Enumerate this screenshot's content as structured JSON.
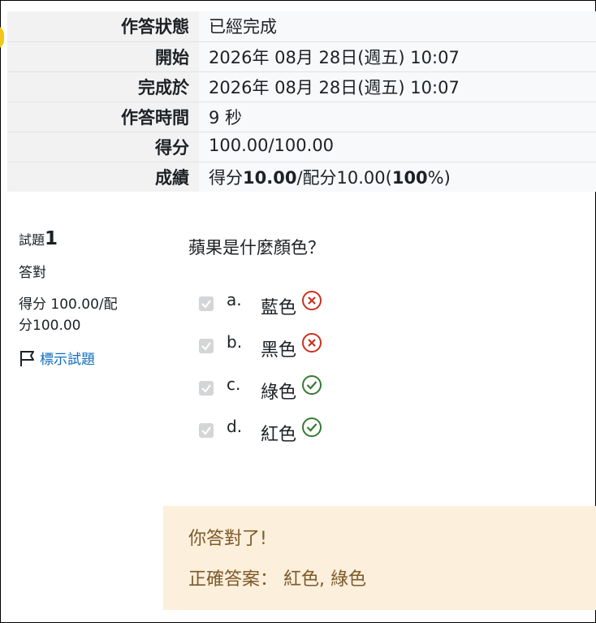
{
  "summary": {
    "rows": [
      {
        "label": "作答狀態",
        "value": "已經完成"
      },
      {
        "label": "開始",
        "value": "2026年 08月 28日(週五) 10:07"
      },
      {
        "label": "完成於",
        "value": "2026年 08月 28日(週五) 10:07"
      },
      {
        "label": "作答時間",
        "value": "9 秒"
      },
      {
        "label": "得分",
        "value": "100.00/100.00"
      }
    ],
    "grade": {
      "label": "成績",
      "prefix": "得分",
      "score": "10.00",
      "mid": "/配分10.00(",
      "percent": "100",
      "suffix": "%)"
    }
  },
  "question": {
    "number_prefix": "試題",
    "number": "1",
    "state": "答對",
    "grade_line1": "得分 100.00/配",
    "grade_line2": "分100.00",
    "flag_label": "標示試題",
    "text": "蘋果是什麼顏色？",
    "answers": [
      {
        "letter": "a.",
        "label": "藍色",
        "correct": false
      },
      {
        "letter": "b.",
        "label": "黑色",
        "correct": false
      },
      {
        "letter": "c.",
        "label": "綠色",
        "correct": true
      },
      {
        "letter": "d.",
        "label": "紅色",
        "correct": true
      }
    ],
    "feedback": "你答對了!",
    "right_answer": "正確答案： 紅色, 綠色"
  },
  "colors": {
    "correct": "#357a32",
    "incorrect": "#ca3120",
    "feedback_bg": "#fcefdc",
    "link": "#0f6cbf"
  }
}
